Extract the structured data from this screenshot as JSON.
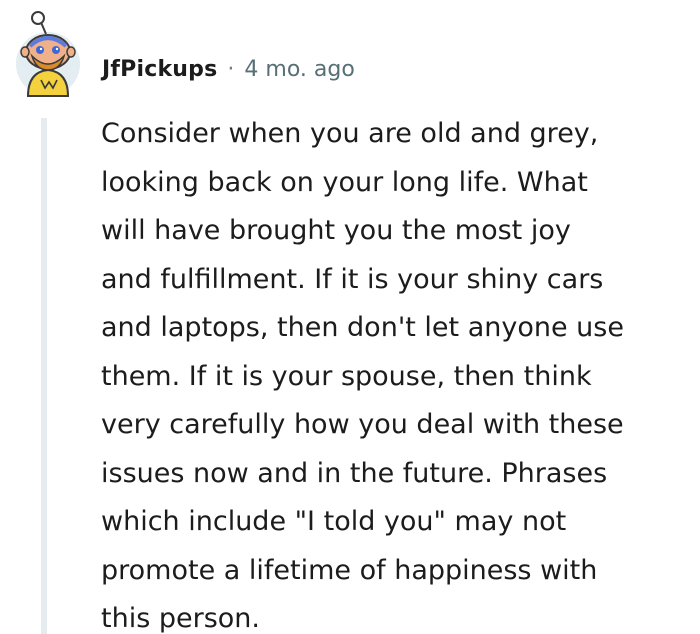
{
  "comment": {
    "username": "JfPickups",
    "separator": "·",
    "timestamp": "4 mo. ago",
    "avatar_icon": "snoo-avatar-icon",
    "body_lines": [
      "Consider when you are old and grey,",
      "looking back on your long life. What",
      "will have brought you the most joy",
      "and fulfillment. If it is your shiny cars",
      "and laptops, then don't let anyone use",
      "them. If it is your spouse, then think",
      "very carefully how you deal with these",
      "issues now and in the future. Phrases",
      "which include \"I told you\" may not",
      "promote a lifetime of happiness with",
      "this person."
    ]
  },
  "colors": {
    "username": "#1c1c1c",
    "meta": "#576f76",
    "thread_line": "#e5ebee",
    "avatar_bg": "#e4edf1",
    "avatar_shirt": "#f3d23d"
  }
}
